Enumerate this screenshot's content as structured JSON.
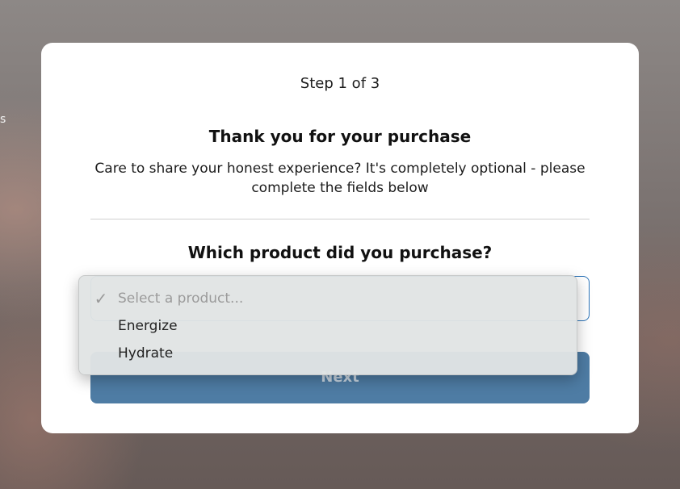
{
  "background": {
    "edge_text": "s"
  },
  "form": {
    "step": "Step 1 of 3",
    "title": "Thank you for your purchase",
    "subtitle_line1": "Care to share your honest experience? It's completely optional - please",
    "subtitle_line2": "complete the fields below",
    "question": "Which product did you purchase?",
    "next_label": "Next"
  },
  "dropdown": {
    "check_icon": "checkmark-icon",
    "options": [
      {
        "label": "Select a product...",
        "selected": true,
        "placeholder": true
      },
      {
        "label": "Energize",
        "selected": false,
        "placeholder": false
      },
      {
        "label": "Hydrate",
        "selected": false,
        "placeholder": false
      }
    ]
  },
  "colors": {
    "accent": "#2a73b8",
    "button": "#4e7ca4"
  }
}
